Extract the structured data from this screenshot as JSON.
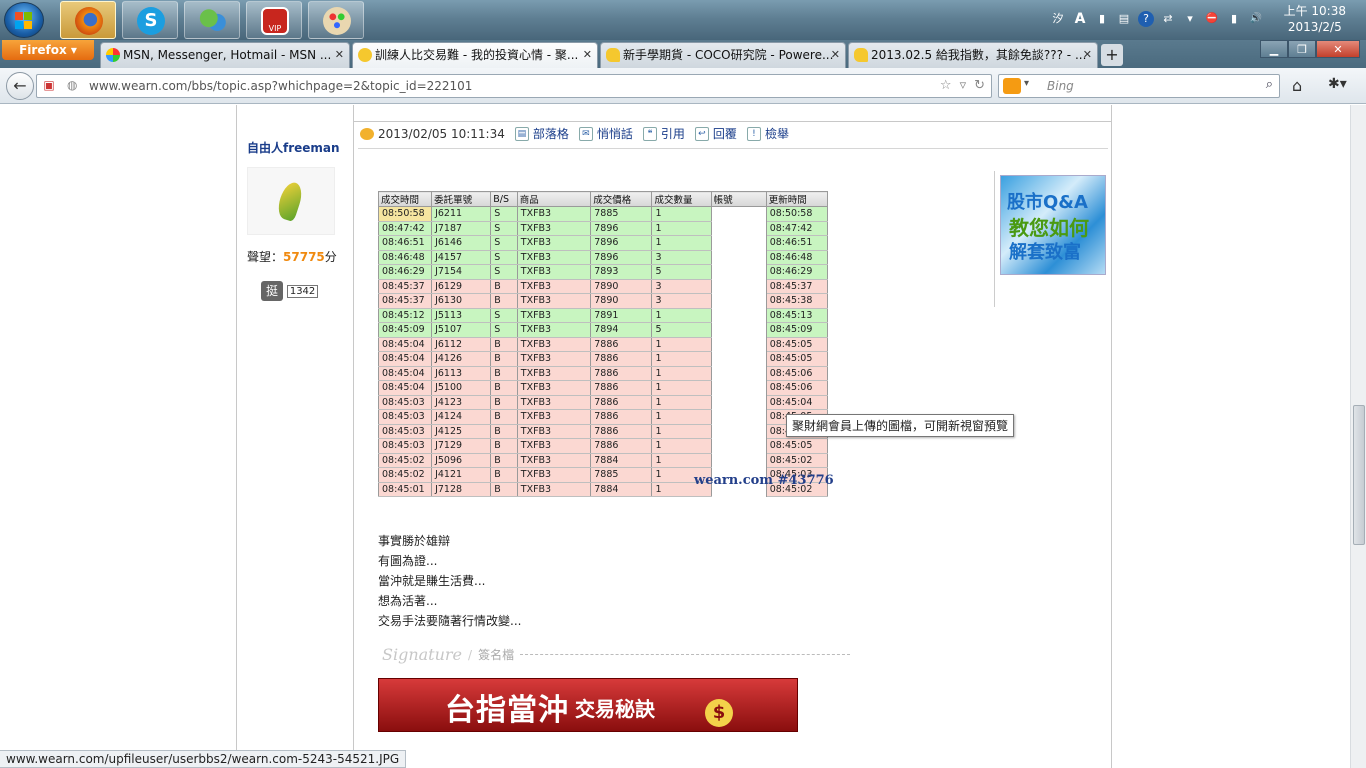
{
  "taskbar": {
    "tray_icons": [
      "input-method-icon",
      "font-a-icon",
      "layout-icon",
      "keyboard-icon",
      "help-icon",
      "network-icon",
      "flag-icon",
      "volume-icon"
    ],
    "tray_glyphs": [
      "汐",
      "A",
      "▮",
      "▤",
      "?",
      "⇄",
      "▾",
      "⛔",
      "▮",
      "🔊"
    ],
    "clock_time": "上午 10:38",
    "clock_date": "2013/2/5"
  },
  "browser": {
    "firefox_label": "Firefox",
    "tabs": [
      {
        "label": "MSN, Messenger, Hotmail - MSN ..."
      },
      {
        "label": "訓練人比交易難 - 我的投資心情 - 聚..."
      },
      {
        "label": "新手學期貨 - COCO研究院 - Powere..."
      },
      {
        "label": "2013.02.5 給我指數，其餘免談??? - ..."
      }
    ],
    "newtab_label": "+",
    "url": "www.wearn.com/bbs/topic.asp?whichpage=2&topic_id=222101",
    "search_placeholder": "Bing"
  },
  "post": {
    "author": "自由人freeman",
    "reputation_label": "聲望：",
    "reputation_value": "57775",
    "reputation_unit": "分",
    "ting_label": "挺",
    "ting_count": "1342",
    "timestamp": "2013/02/05 10:11:34",
    "actions": [
      "部落格",
      "悄悄話",
      "引用",
      "回覆",
      "檢舉"
    ],
    "table_headers": [
      "成交時間",
      "委託單號",
      "B/S",
      "商品",
      "成交價格",
      "成交數量",
      "帳號",
      "更新時間"
    ],
    "table_rows": [
      [
        "08:50:58",
        "J6211",
        "S",
        "TXFB3",
        "7885",
        "1",
        "08:50:58"
      ],
      [
        "08:47:42",
        "J7187",
        "S",
        "TXFB3",
        "7896",
        "1",
        "08:47:42"
      ],
      [
        "08:46:51",
        "J6146",
        "S",
        "TXFB3",
        "7896",
        "1",
        "08:46:51"
      ],
      [
        "08:46:48",
        "J4157",
        "S",
        "TXFB3",
        "7896",
        "3",
        "08:46:48"
      ],
      [
        "08:46:29",
        "J7154",
        "S",
        "TXFB3",
        "7893",
        "5",
        "08:46:29"
      ],
      [
        "08:45:37",
        "J6129",
        "B",
        "TXFB3",
        "7890",
        "3",
        "08:45:37"
      ],
      [
        "08:45:37",
        "J6130",
        "B",
        "TXFB3",
        "7890",
        "3",
        "08:45:38"
      ],
      [
        "08:45:12",
        "J5113",
        "S",
        "TXFB3",
        "7891",
        "1",
        "08:45:13"
      ],
      [
        "08:45:09",
        "J5107",
        "S",
        "TXFB3",
        "7894",
        "5",
        "08:45:09"
      ],
      [
        "08:45:04",
        "J6112",
        "B",
        "TXFB3",
        "7886",
        "1",
        "08:45:05"
      ],
      [
        "08:45:04",
        "J4126",
        "B",
        "TXFB3",
        "7886",
        "1",
        "08:45:05"
      ],
      [
        "08:45:04",
        "J6113",
        "B",
        "TXFB3",
        "7886",
        "1",
        "08:45:06"
      ],
      [
        "08:45:04",
        "J5100",
        "B",
        "TXFB3",
        "7886",
        "1",
        "08:45:06"
      ],
      [
        "08:45:03",
        "J4123",
        "B",
        "TXFB3",
        "7886",
        "1",
        "08:45:04"
      ],
      [
        "08:45:03",
        "J4124",
        "B",
        "TXFB3",
        "7886",
        "1",
        "08:45:05"
      ],
      [
        "08:45:03",
        "J4125",
        "B",
        "TXFB3",
        "7886",
        "1",
        "08:45:06"
      ],
      [
        "08:45:03",
        "J7129",
        "B",
        "TXFB3",
        "7886",
        "1",
        "08:45:05"
      ],
      [
        "08:45:02",
        "J5096",
        "B",
        "TXFB3",
        "7884",
        "1",
        "08:45:02"
      ],
      [
        "08:45:02",
        "J4121",
        "B",
        "TXFB3",
        "7885",
        "1",
        "08:45:03"
      ],
      [
        "08:45:01",
        "J7128",
        "B",
        "TXFB3",
        "7884",
        "1",
        "08:45:02"
      ]
    ],
    "image_watermark": "wearn.com #43776",
    "image_tooltip": "聚財網會員上傳的圖檔，可開新視窗預覽",
    "body_lines": [
      "事實勝於雄辯",
      "有圖為證...",
      "當沖就是賺生活費...",
      "想為活著...",
      "交易手法要隨著行情改變..."
    ],
    "signature_script": "Signature",
    "signature_label": "簽名檔",
    "banner_big": "台指當沖",
    "banner_small": "交易秘訣",
    "banner_symbol": "$",
    "ad_line1": "股市Q&A",
    "ad_line2": "教您如何",
    "ad_line3": "解套致富"
  },
  "status_bar": "www.wearn.com/upfileuser/userbbs2/wearn.com-5243-54521.JPG"
}
